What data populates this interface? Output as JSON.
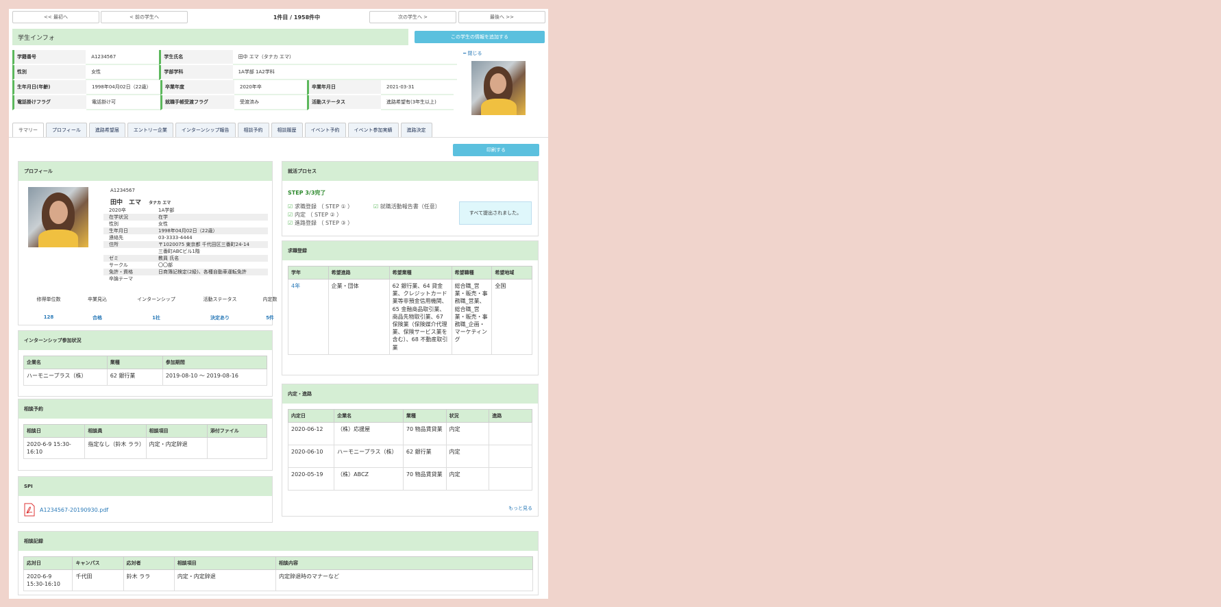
{
  "nav": {
    "first": "<< 最初へ",
    "prev": "< 前の学生へ",
    "counter": "1件目 / 1958件中",
    "next": "次の学生へ >",
    "last": "最後へ >>"
  },
  "header": {
    "title": "学生インフォ",
    "add_button": "この学生の情報を追加する",
    "close_label": "閉じる"
  },
  "info": [
    [
      {
        "label": "学籍番号",
        "value": "A1234567"
      },
      {
        "label": "学生氏名",
        "value": "田中 エマ（タナカ エマ）"
      }
    ],
    [
      {
        "label": "性別",
        "value": "女性"
      },
      {
        "label": "学部学科",
        "value": "1A学部 1A2学科"
      }
    ],
    [
      {
        "label": "生年月日(年齢)",
        "value": "1998年04月02日（22歳）"
      },
      {
        "label": "卒業年度",
        "value": "2020年卒"
      },
      {
        "label": "卒業年月日",
        "value": "2021-03-31"
      }
    ],
    [
      {
        "label": "電話掛けフラグ",
        "value": "電話掛け可"
      },
      {
        "label": "就職手帳受渡フラグ",
        "value": "受渡済み"
      },
      {
        "label": "活動ステータス",
        "value": "進路希望有(3年生以上)"
      }
    ]
  ],
  "tabs": [
    "サマリー",
    "プロフィール",
    "進路希望届",
    "エントリー企業",
    "インターンシップ報告",
    "相談予約",
    "相談履歴",
    "イベント予約",
    "イベント参加実績",
    "進路決定"
  ],
  "print_button": "印刷する",
  "profile": {
    "title": "プロフィール",
    "id": "A1234567",
    "name": "田中　エマ",
    "kana": "タナカ エマ",
    "rows": [
      [
        "2020卒",
        "1A学部"
      ],
      [
        "在学状況",
        "在学"
      ],
      [
        "性別",
        "女性"
      ],
      [
        "生年月日",
        "1998年04月02日（22歳）"
      ],
      [
        "連絡先",
        "03-3333-4444"
      ],
      [
        "住所",
        "〒1020075 東京都 千代田区三番町24-14"
      ],
      [
        "",
        "三番町ABCビル1階"
      ],
      [
        "ゼミ",
        "教員 氏名"
      ],
      [
        "サークル",
        "〇〇部"
      ],
      [
        "免許・資格",
        "日商簿記検定(2級)、各種自動車運転免許"
      ],
      [
        "卒論テーマ",
        ""
      ]
    ],
    "stats": [
      {
        "label": "修得単位数",
        "value": "128"
      },
      {
        "label": "卒業見込",
        "value": "合格"
      },
      {
        "label": "インターンシップ",
        "value": "1社"
      },
      {
        "label": "活動ステータス",
        "value": "決定あり"
      },
      {
        "label": "内定数",
        "value": "5件"
      }
    ]
  },
  "internship": {
    "title": "インターンシップ参加状況",
    "headers": [
      "企業名",
      "業種",
      "参加期間"
    ],
    "rows": [
      [
        "ハーモニープラス（株）",
        "62 銀行業",
        "2019-08-10 ～ 2019-08-16"
      ]
    ]
  },
  "consult_res": {
    "title": "相談予約",
    "headers": [
      "相談日",
      "相談員",
      "相談項目",
      "添付ファイル"
    ],
    "rows": [
      [
        "2020-6-9 15:30-16:10",
        "指定なし（鈴木 ララ）",
        "内定・内定辞退",
        ""
      ]
    ]
  },
  "spi": {
    "title": "SPI",
    "file": "A1234567-20190930.pdf",
    "icon": "pdf-icon"
  },
  "process": {
    "title": "就活プロセス",
    "step": "STEP 3/3完了",
    "items": [
      "求職登録 （ STEP ① ）",
      "内定 （ STEP ② ）",
      "進路登録 （ STEP ③ ）"
    ],
    "extra": "就職活動報告書（任意）",
    "done": "すべて提出されました。"
  },
  "job": {
    "title": "求職登録",
    "headers": [
      "学年",
      "希望進路",
      "希望業種",
      "希望職種",
      "希望地域"
    ],
    "rows": [
      [
        "4年",
        "企業・団体",
        "62 銀行業、64 貸金業、クレジットカード業等非預金信用機関、65 金融商品取引業、商品先物取引業、67 保険業（保険媒介代理業、保険サービス業を含む）、68 不動産取引業",
        "総合職_営業・販売・事務職_営業、総合職_営業・販売・事務職_企画・マーケティング",
        "全国"
      ]
    ]
  },
  "offer": {
    "title": "内定・進路",
    "headers": [
      "内定日",
      "企業名",
      "業種",
      "状況",
      "進路"
    ],
    "rows": [
      [
        "2020-06-12",
        "（株）応援屋",
        "70 物品賃貸業",
        "内定",
        ""
      ],
      [
        "2020-06-10",
        "ハーモニープラス（株）",
        "62 銀行業",
        "内定",
        ""
      ],
      [
        "2020-05-19",
        "（株）ABCZ",
        "70 物品賃貸業",
        "内定",
        ""
      ]
    ],
    "more": "もっと見る"
  },
  "consult_rec": {
    "title": "相談記録",
    "headers": [
      "応対日",
      "キャンパス",
      "応対者",
      "相談項目",
      "相談内容"
    ],
    "rows": [
      [
        "2020-6-9 15:30-16:10",
        "千代田",
        "鈴木 ララ",
        "内定・内定辞退",
        "内定辞退時のマナーなど"
      ]
    ]
  }
}
